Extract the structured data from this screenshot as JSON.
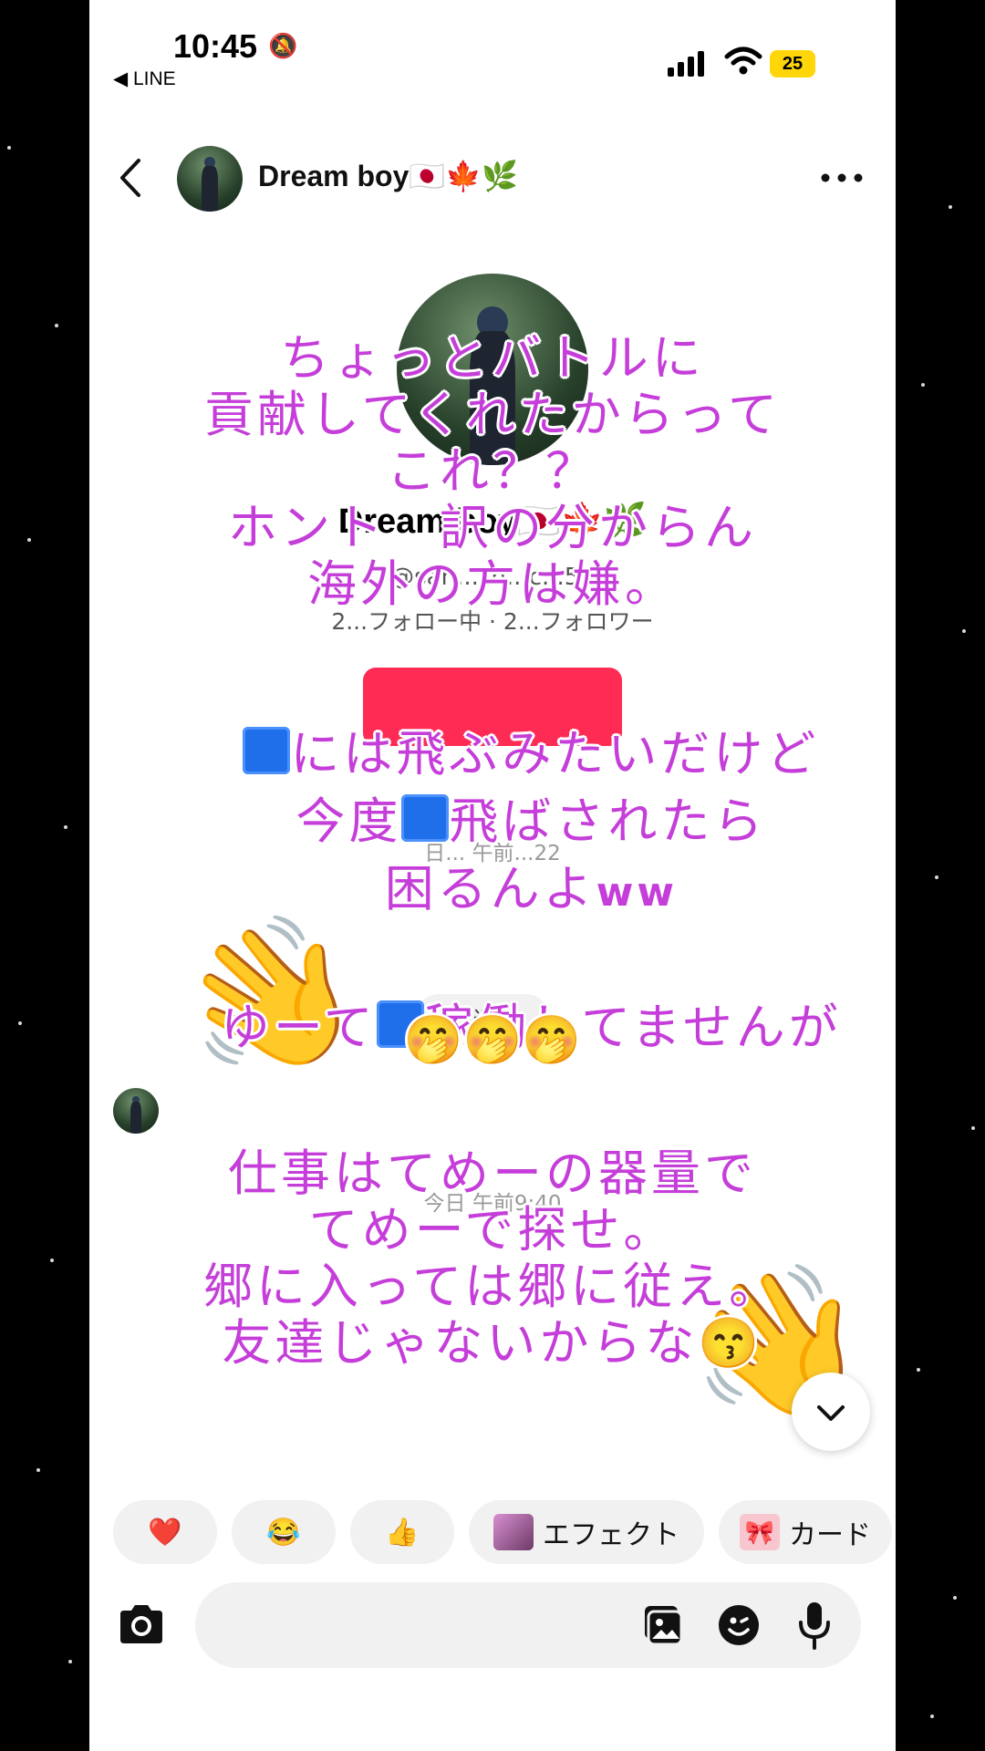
{
  "status_bar": {
    "time": "10:45",
    "back_app": "◀ LINE",
    "battery": "25"
  },
  "header": {
    "name": "Dream boy🇯🇵🍁🌿"
  },
  "profile": {
    "name": "Dream boy🇯🇵🍁🌿",
    "handle": "@san...sh...c...58",
    "stats": "2...フォロー中 · 2...フォロワー"
  },
  "messages": {
    "time1": "日... 午前...22",
    "reply": "返信",
    "time2": "今日 午前9:40"
  },
  "overlay": {
    "block1": "ちょっとバトルに\n貢献してくれたからって\nこれ？？\nホント　訳の分からん\n海外の方は嫌。",
    "line_a_pre": "",
    "line_a_post": "には飛ぶみたいだけど",
    "line_b_pre": "今度",
    "line_b_post": "飛ばされたら",
    "line_c": "困るんよ",
    "line_c_ww": "ww",
    "line_d_pre": "ゆーて",
    "line_d_post": "稼働してませんが",
    "emoji_row": "🤭🤭🤭",
    "block2": "仕事はてめーの器量で\nてめーで探せ。\n郷に入っては郷に従え。\n友達じゃないからな😙"
  },
  "quick_reactions": [
    {
      "label": "❤️"
    },
    {
      "label": "😂"
    },
    {
      "label": "👍"
    },
    {
      "label": "エフェクト"
    },
    {
      "label": "カード"
    }
  ],
  "input": {
    "placeholder": ""
  },
  "colors": {
    "overlay_text": "#c53ed9",
    "follow": "#fe2c55",
    "battery": "#ffd60a"
  }
}
